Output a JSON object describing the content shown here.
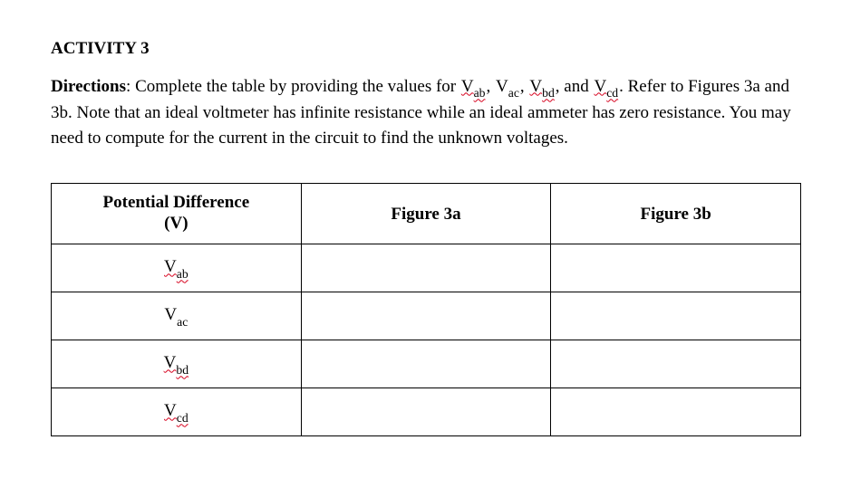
{
  "title": "ACTIVITY 3",
  "directions": {
    "label": "Directions",
    "sep": ": ",
    "text_a": "Complete the table by providing the values for ",
    "v1_main": "V",
    "v1_sub": "ab",
    "c1": ", ",
    "v2_main": "V",
    "v2_sub": "ac",
    "c2": ", ",
    "v3_main": "V",
    "v3_sub": "bd",
    "c3": ", and ",
    "v4_main": "V",
    "v4_sub": "cd",
    "c4": ". ",
    "text_b": "Refer to Figures 3a and 3b. Note that an ideal voltmeter has infinite resistance while an ideal ammeter has zero resistance. You may need to compute for the current in the circuit to find the unknown voltages."
  },
  "table": {
    "headers": {
      "pd_line1": "Potential Difference",
      "pd_line2": "(V)",
      "fig3a": "Figure 3a",
      "fig3b": "Figure 3b"
    },
    "rows": [
      {
        "main": "V",
        "sub": "ab",
        "wavy": true,
        "f3a": "",
        "f3b": ""
      },
      {
        "main": "V",
        "sub": "ac",
        "wavy": false,
        "f3a": "",
        "f3b": ""
      },
      {
        "main": "V",
        "sub": "bd",
        "wavy": true,
        "f3a": "",
        "f3b": ""
      },
      {
        "main": "V",
        "sub": "cd",
        "wavy": true,
        "f3a": "",
        "f3b": ""
      }
    ]
  }
}
